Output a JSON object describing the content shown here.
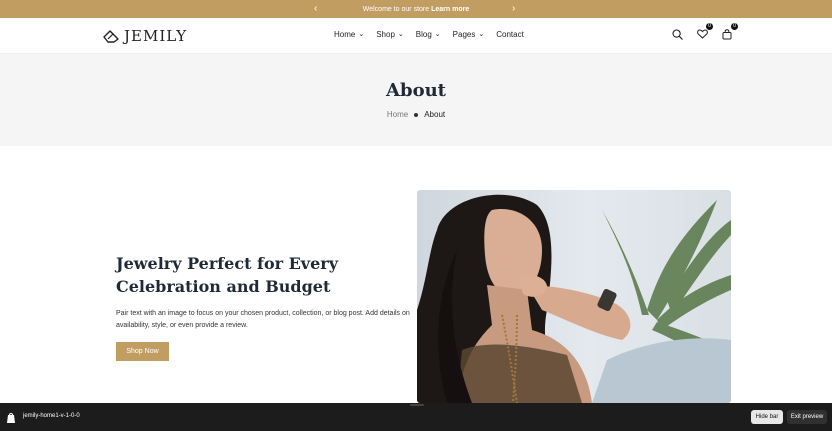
{
  "announcement": {
    "message": "Welcome to our store",
    "link_label": "Learn more",
    "prev_icon": "chevron-left-icon",
    "next_icon": "chevron-right-icon"
  },
  "header": {
    "logo_text": "JEMILY",
    "nav": [
      {
        "label": "Home",
        "has_dropdown": true
      },
      {
        "label": "Shop",
        "has_dropdown": true
      },
      {
        "label": "Blog",
        "has_dropdown": true
      },
      {
        "label": "Pages",
        "has_dropdown": true
      },
      {
        "label": "Contact",
        "has_dropdown": false
      }
    ],
    "icons": [
      "search-icon",
      "wishlist-heart-icon",
      "cart-bag-icon"
    ],
    "wishlist_count": "0",
    "cart_count": "0"
  },
  "page": {
    "title": "About",
    "breadcrumb_home": "Home",
    "breadcrumb_current": "About"
  },
  "content": {
    "heading": "Jewelry Perfect for Every Celebration and Budget",
    "body": "Pair text with an image to focus on your chosen product, collection, or blog post. Add details on availability, style, or even provide a review.",
    "button_label": "Shop Now"
  },
  "preview_bar": {
    "theme_name": "jemily-home1-v-1-0-0",
    "hide_label": "Hide bar",
    "exit_label": "Exit preview"
  },
  "colors": {
    "accent": "#c29d62",
    "band": "#f5f5f5",
    "dark": "#1c1c1c"
  }
}
